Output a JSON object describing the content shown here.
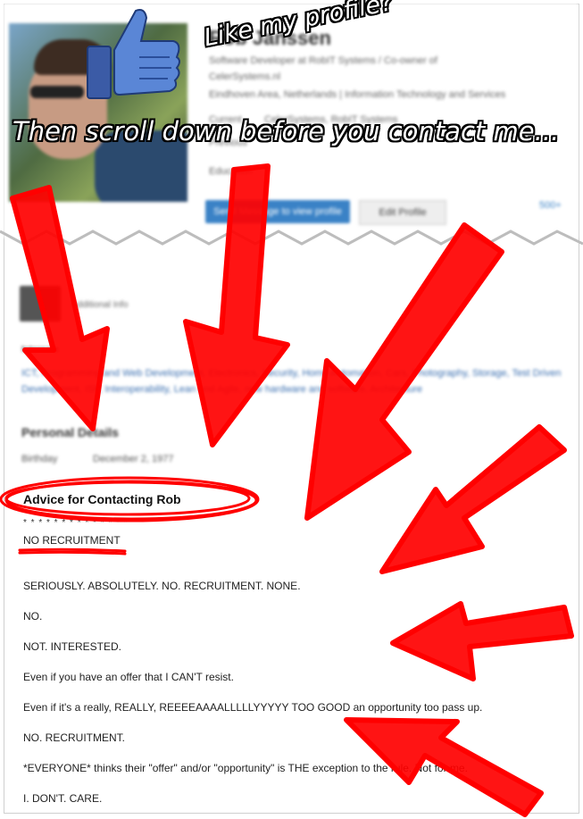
{
  "captions": {
    "like": "Like my profile?",
    "scroll": "Then scroll down before you contact me..."
  },
  "profile": {
    "name": "Rob Janssen",
    "headline": "Software Developer at RobIT Systems / Co-owner of",
    "headline2": "CelerSystems.nl",
    "location": "Eindhoven Area, Netherlands | Information Technology and Services",
    "current_label": "Current",
    "current_value": "CelerSystems, RobIT Systems",
    "previous_label": "Previous",
    "education_label": "Education",
    "primary_button": "Send Message to view profile",
    "secondary_button": "Edit Profile",
    "connections": "500+"
  },
  "middle": {
    "badge": "Additional Info",
    "section_label": "Interests",
    "links1": "ICT, Programming and Web Development, Electronics, Security, Home Automation, Cars, Photography, Storage, Test Driven",
    "links2": "Development, ISP, Interoperability, Lean and Agile, new hardware and software, Architecture",
    "personal_heading": "Personal Details",
    "birthday_label": "Birthday",
    "birthday_value": "December 2, 1977"
  },
  "advice": {
    "title": "Advice for Contacting Rob",
    "stars": "* * * * * * * * * * * * * *",
    "lines": [
      "NO RECRUITMENT",
      "SERIOUSLY. ABSOLUTELY. NO. RECRUITMENT. NONE.",
      "NO.",
      "NOT. INTERESTED.",
      "Even if you have an offer that I CAN'T resist.",
      "Even if it's a really, REALLY, REEEEAAAALLLLLYYYYY TOO GOOD an opportunity too pass up.",
      "NO. RECRUITMENT.",
      "*EVERYONE* thinks their \"offer\" and/or \"opportunity\" is THE exception to the rule. Not for me.",
      "I. DON'T. CARE."
    ]
  },
  "colors": {
    "arrow": "#ff0000",
    "link_blue": "#3a82c6",
    "thumb_blue": "#3b5ba6"
  },
  "icons": {
    "thumb": "thumbs-up-icon"
  }
}
